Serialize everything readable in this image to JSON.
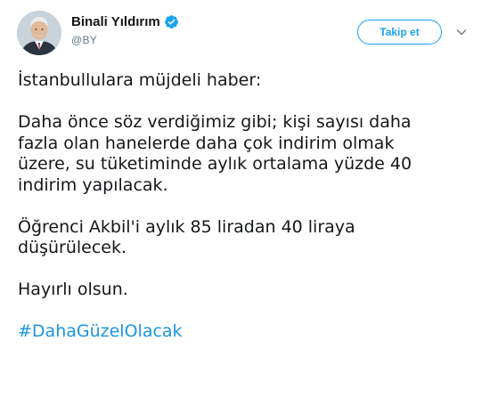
{
  "tweet": {
    "author": {
      "display_name": "Binali Yıldırım",
      "handle": "@BY",
      "verified_icon": "verified-badge-icon",
      "avatar_icon": "profile-avatar"
    },
    "follow_label": "Takip et",
    "menu_icon": "chevron-down-icon",
    "paragraphs": [
      [
        "İstanbullulara müjdeli haber:"
      ],
      [
        "Daha önce söz verdiğimiz gibi; kişi sayısı daha",
        "fazla olan hanelerde daha çok indirim olmak",
        "üzere, su tüketiminde aylık ortalama yüzde 40",
        "indirim yapılacak."
      ],
      [
        "Öğrenci Akbil'i aylık 85 liradan 40 liraya",
        "düşürülecek."
      ],
      [
        "Hayırlı olsun."
      ]
    ],
    "hashtag": "#DahaGüzelOlacak"
  },
  "colors": {
    "accent": "#1da1f2",
    "hashtag": "#1b95e0",
    "text": "#14171a",
    "muted": "#657786"
  }
}
